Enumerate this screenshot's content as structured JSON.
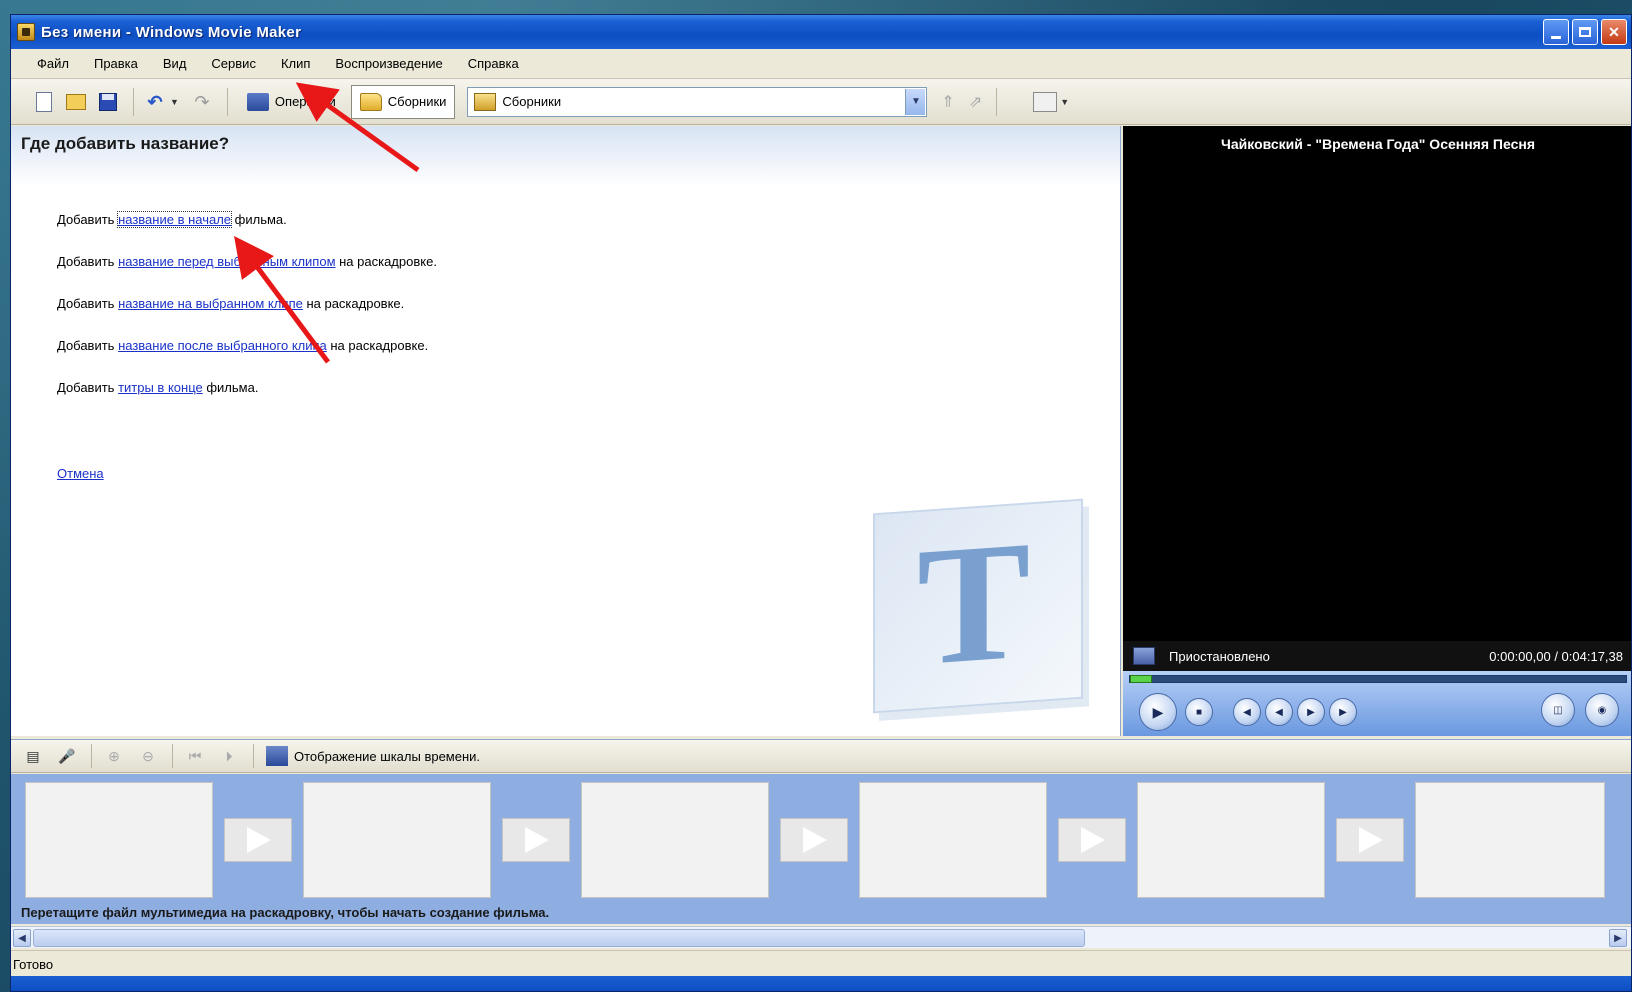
{
  "window": {
    "title": "Без имени - Windows Movie Maker"
  },
  "menu": [
    "Файл",
    "Правка",
    "Вид",
    "Сервис",
    "Клип",
    "Воспроизведение",
    "Справка"
  ],
  "toolbar": {
    "operations_label": "Операции",
    "collections_label": "Сборники",
    "collection_dropdown_value": "Сборники"
  },
  "task_pane": {
    "title": "Где добавить название?",
    "lines": [
      {
        "prefix": "Добавить ",
        "link": "название в начале",
        "suffix": " фильма."
      },
      {
        "prefix": "Добавить ",
        "link": "название перед выбранным клипом",
        "suffix": " на раскадровке."
      },
      {
        "prefix": "Добавить ",
        "link": "название на выбранном клипе",
        "suffix": " на раскадровке."
      },
      {
        "prefix": "Добавить ",
        "link": "название после выбранного клипа",
        "suffix": " на раскадровке."
      },
      {
        "prefix": "Добавить ",
        "link": "титры в конце",
        "suffix": " фильма."
      }
    ],
    "cancel_label": "Отмена",
    "watermark_letter": "T"
  },
  "preview": {
    "title": "Чайковский - \"Времена Года\" Осенняя Песня",
    "status": "Приостановлено",
    "time": "0:00:00,00 / 0:04:17,38"
  },
  "storyboard": {
    "view_toggle_label": "Отображение шкалы времени.",
    "hint": "Перетащите файл мультимедиа на раскадровку, чтобы начать создание фильма."
  },
  "status_bar": {
    "text": "Готово"
  },
  "colors": {
    "annotation_arrow": "#e81818",
    "link": "#1a32c8",
    "title_bar": "#0d4fc3"
  }
}
